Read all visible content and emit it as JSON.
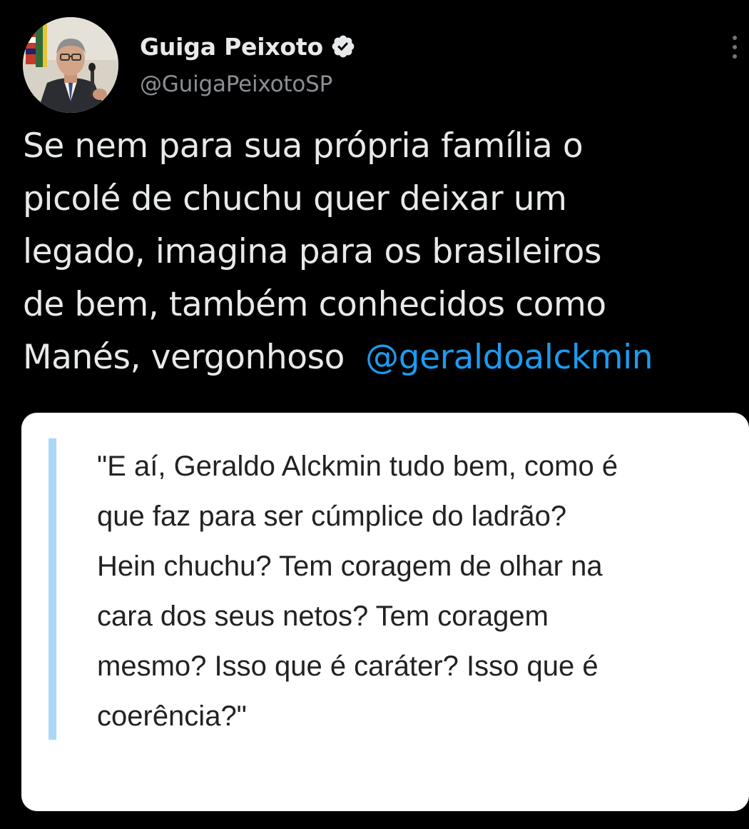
{
  "author": {
    "display_name": "Guiga Peixoto",
    "handle": "@GuigaPeixotoSP",
    "verified": true,
    "avatar_icon": "profile-photo"
  },
  "tweet": {
    "lines": [
      "Se nem para sua própria família o",
      "picolé de chuchu quer deixar um",
      "legado, imagina para os brasileiros",
      "de bem, também conhecidos como",
      "Manés, vergonhoso"
    ],
    "mention": "@geraldoalckmin"
  },
  "quote_image": {
    "lines": [
      "\"E aí, Geraldo Alckmin tudo bem, como é",
      "que faz para ser cúmplice do ladrão?",
      "Hein chuchu? Tem coragem de olhar na",
      "cara dos seus netos? Tem coragem",
      "mesmo? Isso que é caráter? Isso que é",
      "coerência?\""
    ]
  },
  "colors": {
    "background": "#000000",
    "text": "#e7e9ea",
    "handle": "#8b8f94",
    "mention": "#1d9bf0",
    "quote_bar": "#a9d8f6"
  },
  "icons": {
    "verified": "verified-badge-icon",
    "more": "more-options-icon"
  }
}
